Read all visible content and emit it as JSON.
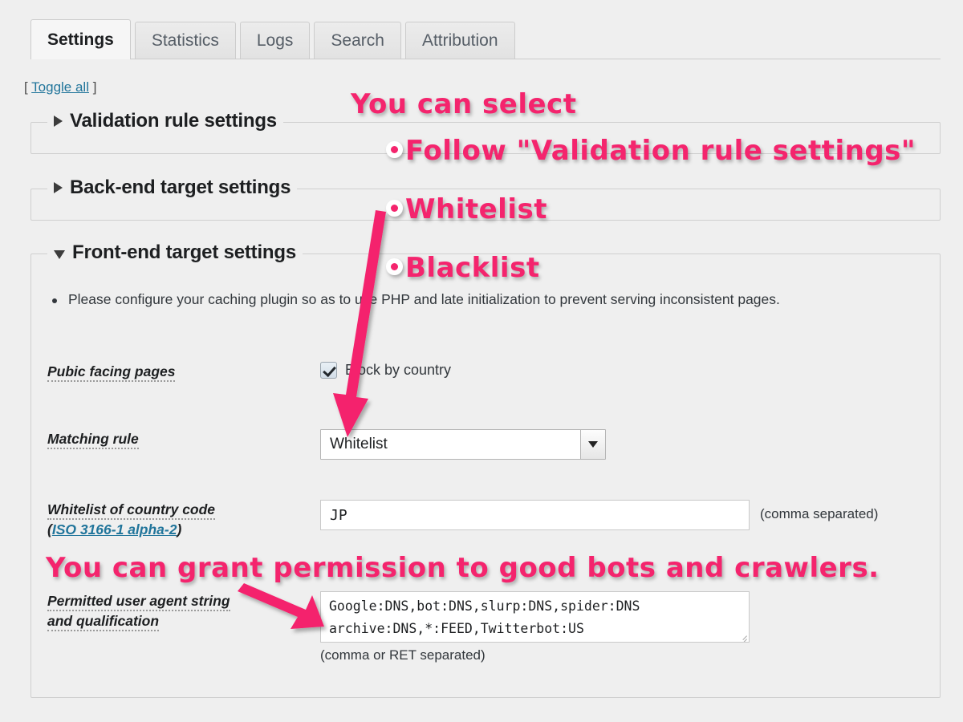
{
  "tabs": [
    {
      "label": "Settings",
      "active": true
    },
    {
      "label": "Statistics",
      "active": false
    },
    {
      "label": "Logs",
      "active": false
    },
    {
      "label": "Search",
      "active": false
    },
    {
      "label": "Attribution",
      "active": false
    }
  ],
  "toggle_all": {
    "open_bracket": "[",
    "link": "Toggle all",
    "close_bracket": "]"
  },
  "sections": [
    {
      "title": "Validation rule settings",
      "state": "collapsed"
    },
    {
      "title": "Back-end target settings",
      "state": "collapsed"
    },
    {
      "title": "Front-end target settings",
      "state": "expanded"
    }
  ],
  "frontend": {
    "notes": [
      "Please configure your caching plugin so as to use PHP and late initialization to prevent serving inconsistent pages."
    ],
    "rows": {
      "pubic_facing": {
        "label": "Pubic facing pages",
        "checkbox_label": "Block by country",
        "checked": true
      },
      "matching_rule": {
        "label": "Matching rule",
        "value": "Whitelist",
        "options": [
          "Follow \"Validation rule settings\"",
          "Whitelist",
          "Blacklist"
        ]
      },
      "country_code": {
        "label_line1": "Whitelist of country code",
        "label_paren_open": "(",
        "label_link": "ISO 3166-1 alpha-2",
        "label_paren_close": ")",
        "value": "JP",
        "hint": "(comma separated)"
      },
      "user_agent": {
        "label_line1": "Permitted user agent string",
        "label_line2": "and qualification",
        "value": "Google:DNS,bot:DNS,slurp:DNS,spider:DNS\narchive:DNS,*:FEED,Twitterbot:US",
        "hint": "(comma or RET separated)"
      }
    }
  },
  "annotations": {
    "line1": "You can select",
    "line2": "Follow \"Validation rule settings\"",
    "line3": "Whitelist",
    "line4": "Blacklist",
    "line5": "You can grant permission to good bots and crawlers."
  },
  "colors": {
    "annotation_pink": "#f4246d",
    "annotation_outline": "#ffffff",
    "link_blue": "#21759b",
    "page_background": "#efefef",
    "active_tab_background": "#f6f6f6",
    "inactive_tab_background": "#e4e4e4"
  }
}
